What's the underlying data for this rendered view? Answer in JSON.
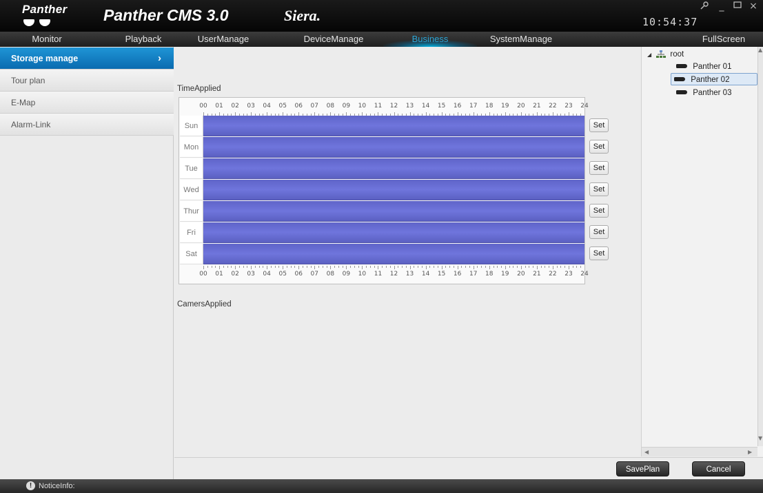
{
  "brand": {
    "logo_text": "Panther"
  },
  "app_title": "Panther CMS 3.0",
  "partner_logo": "Siera.",
  "clock": "10:54:37",
  "nav": {
    "items": [
      {
        "label": "Monitor"
      },
      {
        "label": "Playback"
      },
      {
        "label": "UserManage"
      },
      {
        "label": "DeviceManage"
      },
      {
        "label": "Business"
      },
      {
        "label": "SystemManage"
      },
      {
        "label": "FullScreen"
      }
    ],
    "active": "Business"
  },
  "sidebar": {
    "items": [
      {
        "label": "Storage manage",
        "active": true
      },
      {
        "label": "Tour plan"
      },
      {
        "label": "E-Map"
      },
      {
        "label": "Alarm-Link"
      }
    ]
  },
  "main": {
    "time_applied_label": "TimeApplied",
    "cameras_applied_label": "CamersApplied",
    "hours": [
      "00",
      "01",
      "02",
      "03",
      "04",
      "05",
      "06",
      "07",
      "08",
      "09",
      "10",
      "11",
      "12",
      "13",
      "14",
      "15",
      "16",
      "17",
      "18",
      "19",
      "20",
      "21",
      "22",
      "23",
      "24"
    ],
    "days": [
      {
        "label": "Sun",
        "set": "Set",
        "level": 1.0
      },
      {
        "label": "Mon",
        "set": "Set",
        "level": 1.0
      },
      {
        "label": "Tue",
        "set": "Set",
        "level": 1.0
      },
      {
        "label": "Wed",
        "set": "Set",
        "level": 1.0
      },
      {
        "label": "Thur",
        "set": "Set",
        "level": 1.0
      },
      {
        "label": "Fri",
        "set": "Set",
        "level": 1.0
      },
      {
        "label": "Sat",
        "set": "Set",
        "level": 1.0
      }
    ],
    "schedule_color": "#6468d0"
  },
  "tree": {
    "root": "root",
    "children": [
      {
        "label": "Panther 01"
      },
      {
        "label": "Panther 02",
        "selected": true
      },
      {
        "label": "Panther 03"
      }
    ]
  },
  "actions": {
    "save": "SavePlan",
    "cancel": "Cancel"
  },
  "status": {
    "notice_label": "NoticeInfo:"
  },
  "colors": {
    "accent": "#1f95d6",
    "active_nav": "#2aa5d6"
  }
}
